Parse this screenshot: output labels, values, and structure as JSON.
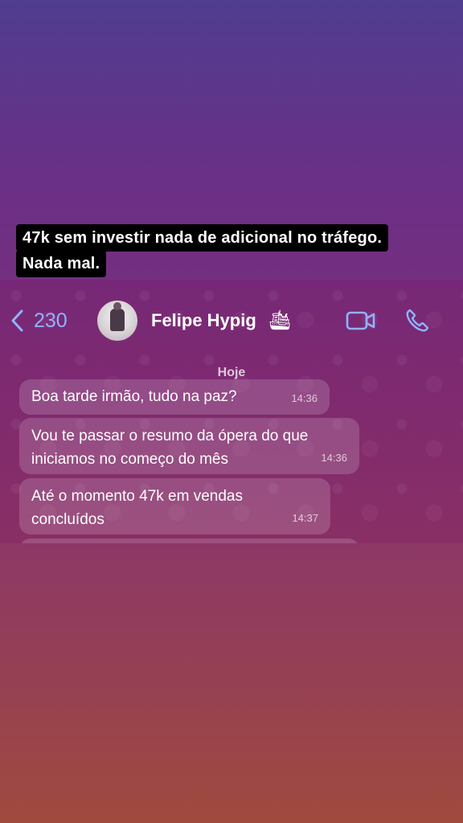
{
  "caption": {
    "line1": "47k sem investir nada de adicional no tráfego.",
    "line2": "Nada mal."
  },
  "header": {
    "back_count": "230",
    "contact_name": "Felipe Hypig",
    "emoji": "🛳",
    "icons": [
      "chevron-left-icon",
      "video-call-icon",
      "phone-icon"
    ],
    "accent_color": "#8fb3ff"
  },
  "chat": {
    "day_label": "Hoje",
    "messages": [
      {
        "text": "Boa tarde irmão, tudo na paz?",
        "time": "14:36"
      },
      {
        "text": "Vou te passar o resumo da ópera do que iniciamos no começo do mês",
        "time": "14:36"
      },
      {
        "text": "Até o momento 47k em vendas concluídos",
        "time": "14:37"
      }
    ]
  }
}
